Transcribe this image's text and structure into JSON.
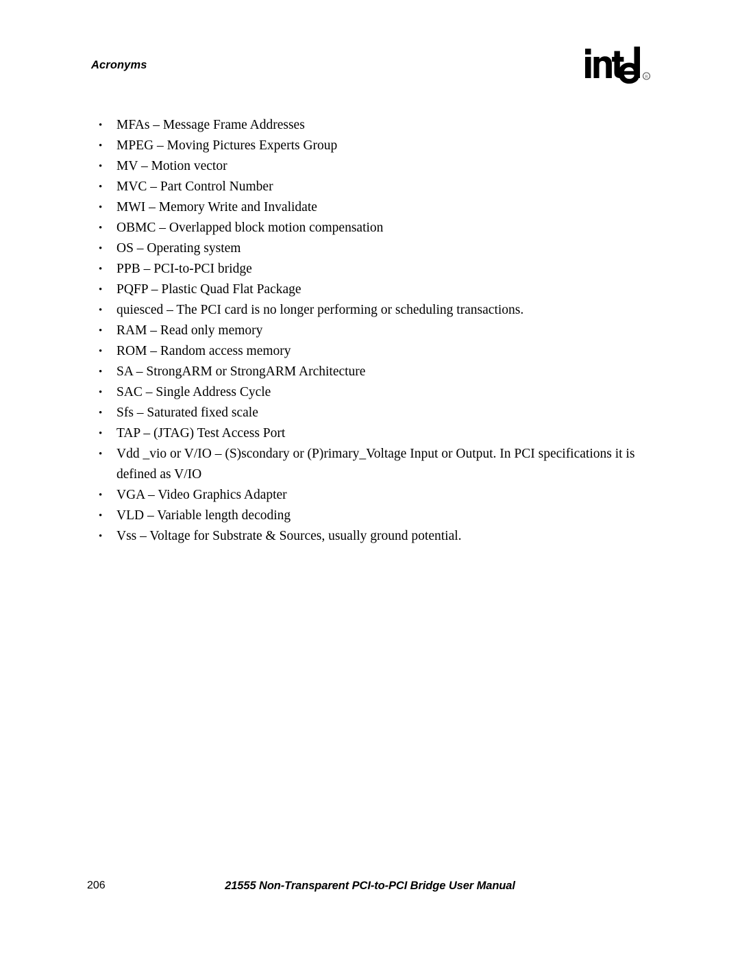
{
  "header": {
    "section_title": "Acronyms",
    "logo": {
      "wordmark": "intel",
      "trademark_symbol": "®"
    }
  },
  "body": {
    "list_items": [
      {
        "text": "MFAs – Message Frame Addresses"
      },
      {
        "text": "MPEG – Moving Pictures Experts Group"
      },
      {
        "text": "MV – Motion vector"
      },
      {
        "text": "MVC – Part Control Number"
      },
      {
        "text": "MWI – Memory Write and Invalidate"
      },
      {
        "text": "OBMC – Overlapped block motion compensation"
      },
      {
        "text": "OS – Operating system"
      },
      {
        "text": "PPB – PCI-to-PCI bridge"
      },
      {
        "text": "PQFP – Plastic Quad Flat Package"
      },
      {
        "text": "quiesced – The PCI card is no longer performing or scheduling transactions."
      },
      {
        "text": "RAM – Read only memory"
      },
      {
        "text": "ROM – Random access memory"
      },
      {
        "text": "SA – StrongARM or StrongARM Architecture"
      },
      {
        "text": "SAC – Single Address Cycle"
      },
      {
        "text": "Sfs – Saturated fixed scale"
      },
      {
        "text": "TAP – (JTAG) Test Access Port"
      },
      {
        "text": "Vdd _vio or V/IO – (S)scondary or (P)rimary_Voltage Input or Output. In PCI specifications it is defined as V/IO"
      },
      {
        "text": "VGA – Video Graphics Adapter"
      },
      {
        "text": "VLD – Variable length decoding"
      },
      {
        "text": "Vss – Voltage for Substrate & Sources, usually ground potential."
      }
    ],
    "bullet_glyph": "•"
  },
  "footer": {
    "page_number": "206",
    "manual_title": "21555 Non-Transparent PCI-to-PCI Bridge User Manual"
  }
}
